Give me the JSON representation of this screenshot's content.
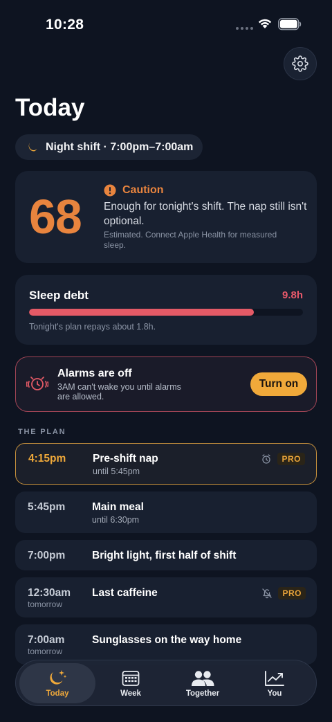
{
  "status_bar": {
    "time": "10:28"
  },
  "header": {
    "title": "Today"
  },
  "shift": {
    "label": "Night shift · 7:00pm–7:00am"
  },
  "score": {
    "value": "68",
    "status": "Caution",
    "message": "Enough for tonight's shift. The nap still isn't optional.",
    "note": "Estimated. Connect Apple Health for measured sleep.",
    "color": "#e8843e"
  },
  "sleep_debt": {
    "title": "Sleep debt",
    "value": "9.8h",
    "fraction": 0.82,
    "note": "Tonight's plan repays about 1.8h.",
    "color": "#e45a66"
  },
  "alarm": {
    "title": "Alarms are off",
    "subtitle": "3AM can't wake you until alarms are allowed.",
    "button_label": "Turn on"
  },
  "plan": {
    "section_label": "THE PLAN",
    "items": [
      {
        "time": "4:15pm",
        "when": "",
        "title": "Pre-shift nap",
        "until": "until 5:45pm",
        "icon": "alarm-clock-icon",
        "badge": "PRO"
      },
      {
        "time": "5:45pm",
        "when": "",
        "title": "Main meal",
        "until": "until 6:30pm",
        "icon": "",
        "badge": ""
      },
      {
        "time": "7:00pm",
        "when": "",
        "title": "Bright light, first half of shift",
        "until": "",
        "icon": "",
        "badge": ""
      },
      {
        "time": "12:30am",
        "when": "tomorrow",
        "title": "Last caffeine",
        "until": "",
        "icon": "bell-off-icon",
        "badge": "PRO"
      },
      {
        "time": "7:00am",
        "when": "tomorrow",
        "title": "Sunglasses on the way home",
        "until": "",
        "icon": "",
        "badge": ""
      }
    ]
  },
  "tabs": [
    {
      "label": "Today",
      "icon": "moon-stars-icon",
      "active": true
    },
    {
      "label": "Week",
      "icon": "calendar-icon",
      "active": false
    },
    {
      "label": "Together",
      "icon": "people-icon",
      "active": false
    },
    {
      "label": "You",
      "icon": "trend-chart-icon",
      "active": false
    }
  ],
  "colors": {
    "accent": "#f0a93a",
    "background": "#0e1421",
    "card": "#182030",
    "danger": "#e9596b"
  }
}
